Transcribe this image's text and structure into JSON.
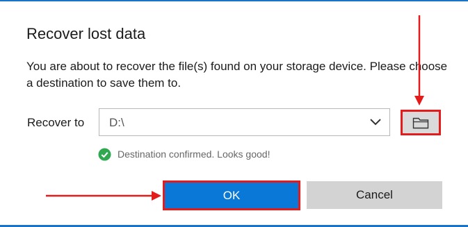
{
  "dialog": {
    "title": "Recover lost data",
    "description": "You are about to recover the file(s) found on your storage device. Please choose a destination to save them to.",
    "recover_to_label": "Recover to",
    "destination_value": "D:\\",
    "status_text": "Destination confirmed. Looks good!",
    "ok_label": "OK",
    "cancel_label": "Cancel"
  },
  "icons": {
    "browse": "folder-icon",
    "dropdown": "chevron-down-icon",
    "status": "check-circle-icon"
  },
  "colors": {
    "accent": "#0a78d6",
    "highlight": "#e31b1b",
    "success": "#2fa84f",
    "frame": "#1a73c7"
  }
}
